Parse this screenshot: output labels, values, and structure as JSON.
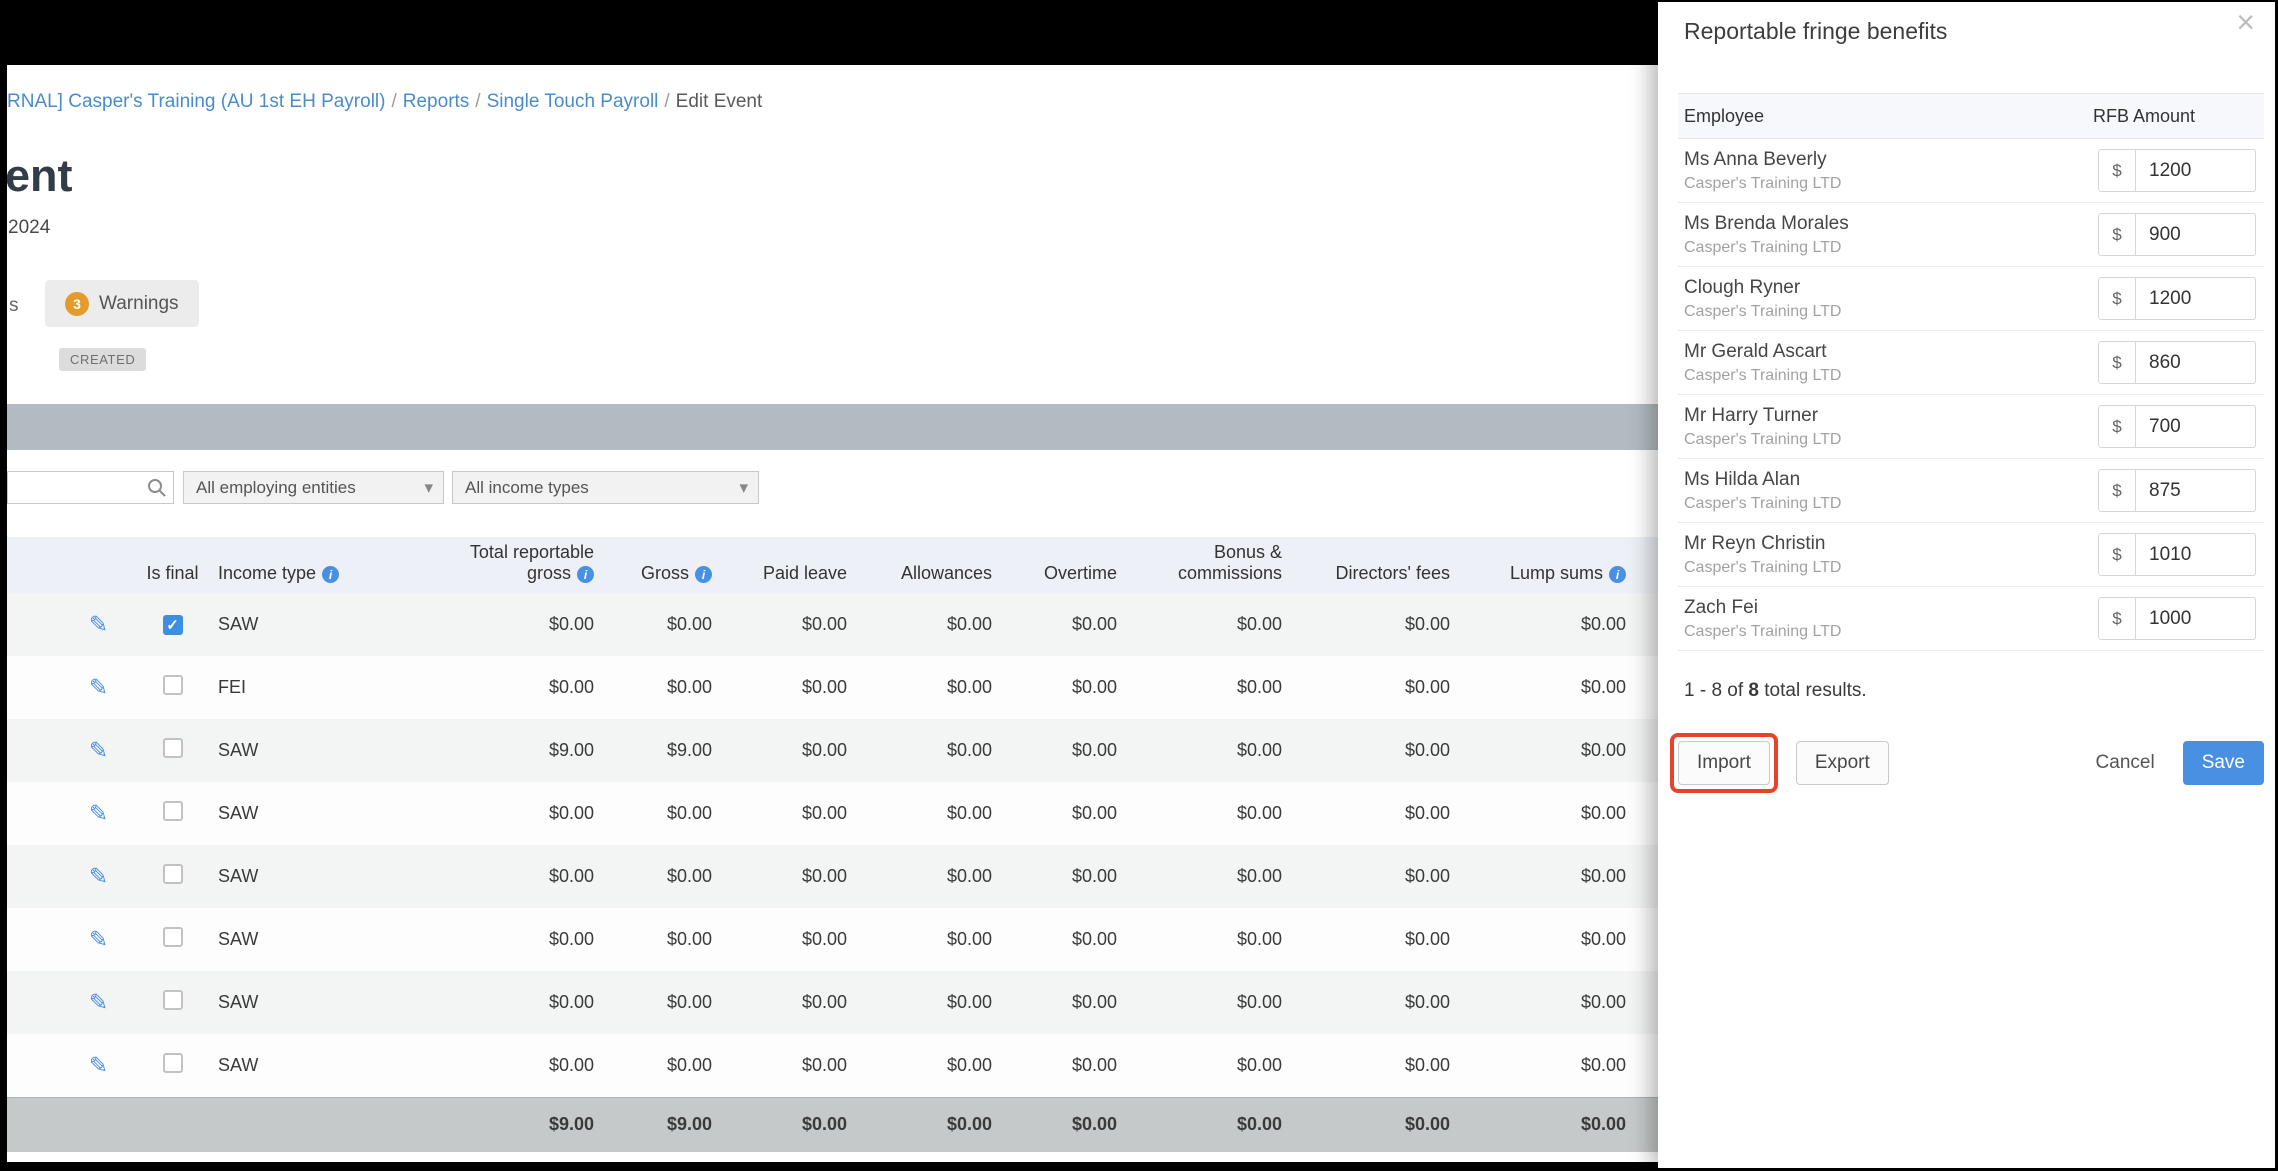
{
  "icons": {
    "edit": "✎",
    "caret": "▾",
    "close": "×",
    "info": "i"
  },
  "colors": {
    "accent_blue": "#4a90e2",
    "warning_badge": "#e59b2c",
    "annotation": "#e8432a",
    "band_gray": "#b2bcc0"
  },
  "breadcrumb": {
    "separator": "/",
    "items": [
      "RNAL] Casper's Training (AU 1st EH Payroll)",
      "Reports",
      "Single Touch Payroll",
      "Edit Event"
    ]
  },
  "page": {
    "title_fragment": "ent",
    "date_fragment": "2024",
    "status_badge": "CREATED",
    "partial_tab_fragment": "s"
  },
  "tabs": {
    "warnings_count": "3",
    "warnings_label": "Warnings"
  },
  "filters": {
    "search_value": "",
    "employing_entities": "All employing entities",
    "income_types": "All income types"
  },
  "table": {
    "headers": {
      "is_final": "Is final",
      "income_type": "Income type",
      "total_reportable_line1": "Total reportable",
      "total_reportable_line2": "gross",
      "gross": "Gross",
      "paid_leave": "Paid leave",
      "allowances": "Allowances",
      "overtime": "Overtime",
      "bonus_line1": "Bonus &",
      "bonus_line2": "commissions",
      "directors_fees": "Directors' fees",
      "lump_sums": "Lump sums"
    },
    "rows": [
      {
        "income_type": "SAW",
        "is_final": true,
        "values": [
          "$0.00",
          "$0.00",
          "$0.00",
          "$0.00",
          "$0.00",
          "$0.00",
          "$0.00",
          "$0.00"
        ]
      },
      {
        "income_type": "FEI",
        "is_final": false,
        "values": [
          "$0.00",
          "$0.00",
          "$0.00",
          "$0.00",
          "$0.00",
          "$0.00",
          "$0.00",
          "$0.00"
        ]
      },
      {
        "income_type": "SAW",
        "is_final": false,
        "values": [
          "$9.00",
          "$9.00",
          "$0.00",
          "$0.00",
          "$0.00",
          "$0.00",
          "$0.00",
          "$0.00"
        ]
      },
      {
        "income_type": "SAW",
        "is_final": false,
        "values": [
          "$0.00",
          "$0.00",
          "$0.00",
          "$0.00",
          "$0.00",
          "$0.00",
          "$0.00",
          "$0.00"
        ]
      },
      {
        "income_type": "SAW",
        "is_final": false,
        "values": [
          "$0.00",
          "$0.00",
          "$0.00",
          "$0.00",
          "$0.00",
          "$0.00",
          "$0.00",
          "$0.00"
        ]
      },
      {
        "income_type": "SAW",
        "is_final": false,
        "values": [
          "$0.00",
          "$0.00",
          "$0.00",
          "$0.00",
          "$0.00",
          "$0.00",
          "$0.00",
          "$0.00"
        ]
      },
      {
        "income_type": "SAW",
        "is_final": false,
        "values": [
          "$0.00",
          "$0.00",
          "$0.00",
          "$0.00",
          "$0.00",
          "$0.00",
          "$0.00",
          "$0.00"
        ]
      },
      {
        "income_type": "SAW",
        "is_final": false,
        "values": [
          "$0.00",
          "$0.00",
          "$0.00",
          "$0.00",
          "$0.00",
          "$0.00",
          "$0.00",
          "$0.00"
        ]
      }
    ],
    "totals": [
      "$9.00",
      "$9.00",
      "$0.00",
      "$0.00",
      "$0.00",
      "$0.00",
      "$0.00",
      "$0.00"
    ]
  },
  "modal": {
    "title": "Reportable fringe benefits",
    "columns": {
      "employee": "Employee",
      "amount": "RFB Amount"
    },
    "currency": "$",
    "rows": [
      {
        "name": "Ms Anna Beverly",
        "company": "Casper's Training LTD",
        "amount": "1200"
      },
      {
        "name": "Ms Brenda Morales",
        "company": "Casper's Training LTD",
        "amount": "900"
      },
      {
        "name": "Clough Ryner",
        "company": "Casper's Training LTD",
        "amount": "1200"
      },
      {
        "name": "Mr Gerald Ascart",
        "company": "Casper's Training LTD",
        "amount": "860"
      },
      {
        "name": "Mr Harry Turner",
        "company": "Casper's Training LTD",
        "amount": "700"
      },
      {
        "name": "Ms Hilda Alan",
        "company": "Casper's Training LTD",
        "amount": "875"
      },
      {
        "name": "Mr Reyn Christin",
        "company": "Casper's Training LTD",
        "amount": "1010"
      },
      {
        "name": "Zach Fei",
        "company": "Casper's Training LTD",
        "amount": "1000"
      }
    ],
    "results": {
      "prefix": "1 - 8 of ",
      "bold": "8",
      "suffix": " total results."
    },
    "buttons": {
      "import": "Import",
      "export": "Export",
      "cancel": "Cancel",
      "save": "Save"
    }
  }
}
